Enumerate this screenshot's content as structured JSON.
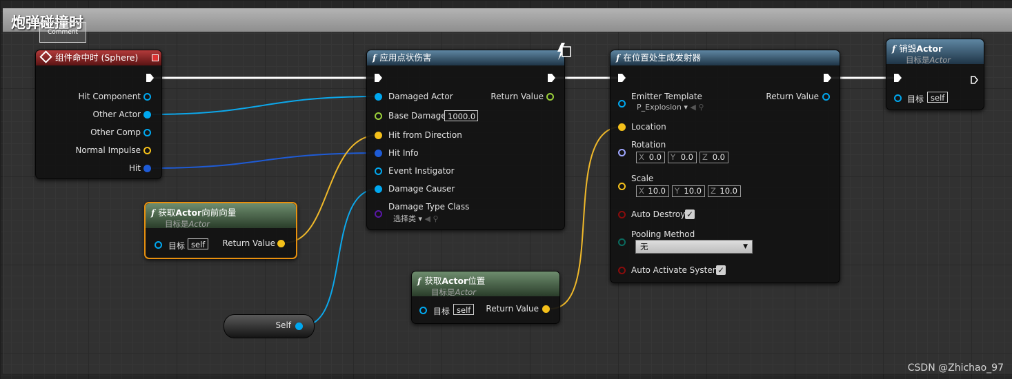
{
  "comment": {
    "title": "炮弹碰撞时",
    "ghost_label": "Comment"
  },
  "event_node": {
    "title": "组件命中时 (Sphere)",
    "pins": [
      "Hit Component",
      "Other Actor",
      "Other Comp",
      "Normal Impulse",
      "Hit"
    ]
  },
  "apply_damage": {
    "title": "应用点状伤害",
    "inputs": [
      "Damaged Actor",
      "Base Damage",
      "Hit from Direction",
      "Hit Info",
      "Event Instigator",
      "Damage Causer",
      "Damage Type Class"
    ],
    "base_damage_value": "1000.0",
    "damage_type_value": "选择类",
    "return_label": "Return Value"
  },
  "forward_vector": {
    "title_prefix": "获取",
    "title_bold": "Actor",
    "title_suffix": "向前向量",
    "subtitle_prefix": "目标是",
    "subtitle_italic": "Actor",
    "target_label": "目标",
    "target_value": "self",
    "return_label": "Return Value"
  },
  "self_node": {
    "label": "Self"
  },
  "actor_location": {
    "title_prefix": "获取",
    "title_bold": "Actor",
    "title_suffix": "位置",
    "subtitle_prefix": "目标是",
    "subtitle_italic": "Actor",
    "target_label": "目标",
    "target_value": "self",
    "return_label": "Return Value"
  },
  "spawn_emitter": {
    "title": "在位置处生成发射器",
    "emitter_label": "Emitter Template",
    "emitter_value": "P_Explosion",
    "location_label": "Location",
    "rotation_label": "Rotation",
    "rotation": {
      "x": "0.0",
      "y": "0.0",
      "z": "0.0"
    },
    "scale_label": "Scale",
    "scale": {
      "x": "10.0",
      "y": "10.0",
      "z": "10.0"
    },
    "auto_destroy_label": "Auto Destroy",
    "pooling_label": "Pooling Method",
    "pooling_value": "无",
    "auto_activate_label": "Auto Activate System",
    "return_label": "Return Value",
    "axis_x": "X",
    "axis_y": "Y",
    "axis_z": "Z"
  },
  "destroy_actor": {
    "title_prefix": "销毁",
    "title_bold": "Actor",
    "subtitle_prefix": "目标是",
    "subtitle_italic": "Actor",
    "target_label": "目标",
    "target_value": "self"
  },
  "watermark": "CSDN @Zhichao_97",
  "colors": {
    "object_pin": "#00a8f0",
    "vector_pin": "#f4c01a",
    "struct_pin": "#1e5bd6",
    "float_pin": "#9cd13b",
    "class_pin": "#5a17a8",
    "rotator_pin": "#9fa7ff",
    "bool_pin": "#8a0c0c",
    "enum_pin": "#0a6b5f",
    "selection": "#e8900e"
  }
}
